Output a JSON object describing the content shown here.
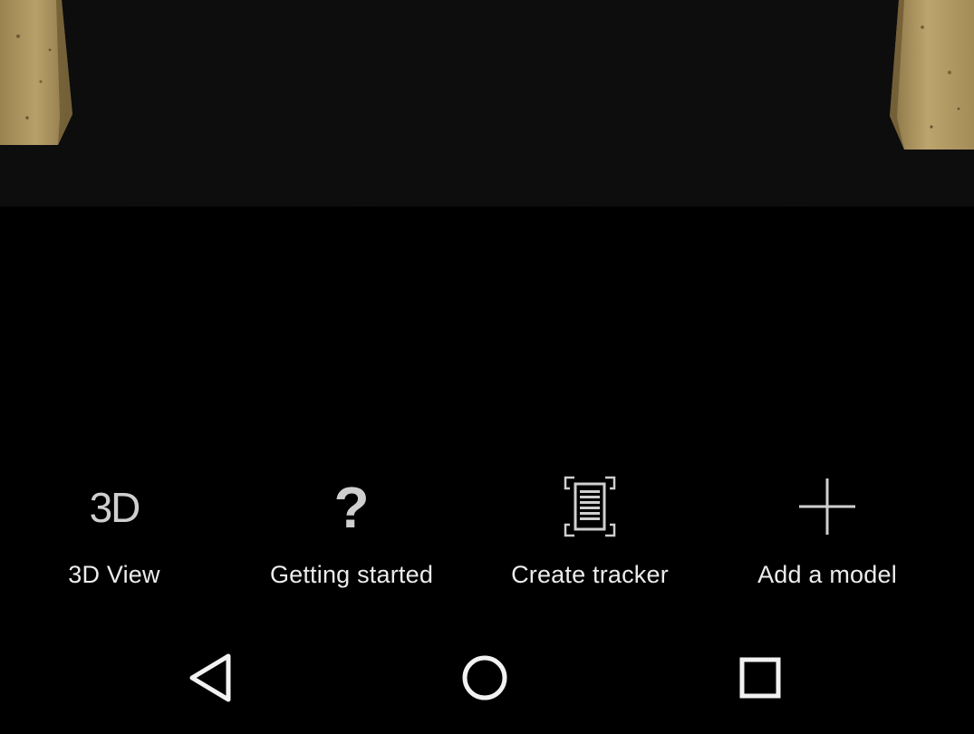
{
  "scene": {
    "background": "#000000",
    "floor_color": "#0d0d0d",
    "pillar_color": "#b39a60"
  },
  "actions": [
    {
      "label": "3D View",
      "icon": "3d-view-icon",
      "icon_text": "3D"
    },
    {
      "label": "Getting started",
      "icon": "question-icon",
      "icon_text": "?"
    },
    {
      "label": "Create tracker",
      "icon": "tracker-icon"
    },
    {
      "label": "Add a model",
      "icon": "plus-icon"
    }
  ],
  "nav": {
    "back": "back-icon",
    "home": "home-icon",
    "recents": "recents-icon"
  },
  "colors": {
    "icon": "#cfcfcf",
    "label": "#ececec",
    "nav_icon": "#f2f2f2"
  }
}
